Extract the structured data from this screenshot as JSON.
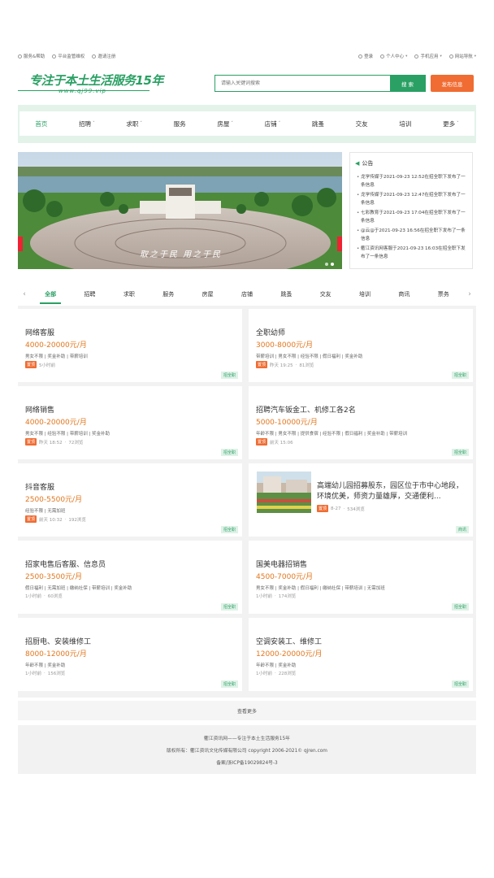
{
  "topbar": {
    "left": [
      "服务&帮助",
      "平台监管维权",
      "邀请注册"
    ],
    "right": [
      {
        "label": "登录",
        "caret": false
      },
      {
        "label": "个人中心",
        "caret": true
      },
      {
        "label": "手机应用",
        "caret": true
      },
      {
        "label": "网站导航",
        "caret": true
      }
    ]
  },
  "logo": {
    "title": "专注于本土生活服务15年",
    "url": "www.qj99.vip"
  },
  "search": {
    "placeholder": "请输入关键词搜索",
    "button": "搜 索"
  },
  "post_button": "发布信息",
  "nav": [
    {
      "label": "首页",
      "caret": false,
      "active": true
    },
    {
      "label": "招聘",
      "caret": true
    },
    {
      "label": "求职",
      "caret": true
    },
    {
      "label": "服务",
      "caret": false
    },
    {
      "label": "房屋",
      "caret": true
    },
    {
      "label": "店铺",
      "caret": true
    },
    {
      "label": "跳蚤",
      "caret": false
    },
    {
      "label": "交友",
      "caret": false
    },
    {
      "label": "培训",
      "caret": false
    },
    {
      "label": "更多",
      "caret": true
    }
  ],
  "banner": {
    "caption": "取之于民  用之于民",
    "slides": 2,
    "active_slide": 1
  },
  "notice": {
    "title": "公告",
    "items": [
      "龙学传媒于2021-09-23 12:52在招全职下发布了一条信息",
      "龙学传媒于2021-09-23 12:47在招全职下发布了一条信息",
      "七彩教育于2021-09-23 17:04在招全职下发布了一条信息",
      "@云@于2021-09-23 16:56在招全职下发布了一条信息",
      "衢江资讯网客服于2021-09-23 16:03在招全职下发布了一条信息"
    ]
  },
  "categories": {
    "items": [
      "全部",
      "招聘",
      "求职",
      "服务",
      "房屋",
      "店铺",
      "跳蚤",
      "交友",
      "培训",
      "商讯",
      "票务"
    ],
    "active_index": 0
  },
  "listings": [
    {
      "title": "网络客服",
      "price": "4000-20000元/月",
      "tags": "男女不限 | 奖金补助 | 带薪培训",
      "top": "置顶",
      "time": "5小时前",
      "views": "",
      "type": "招全职"
    },
    {
      "title": "全职幼师",
      "price": "3000-8000元/月",
      "tags": "带薪培训 | 男女不限 | 经验不限 | 假日福利 | 奖金补助",
      "top": "置顶",
      "time": "昨天 19:25",
      "views": "81浏览",
      "type": "招全职"
    },
    {
      "title": "网络销售",
      "price": "4000-20000元/月",
      "tags": "男女不限 | 经验不限 | 带薪培训 | 奖金补助",
      "top": "置顶",
      "time": "昨天 18:52",
      "views": "72浏览",
      "type": "招全职"
    },
    {
      "title": "招聘汽车钣金工、机修工各2名",
      "price": "5000-10000元/月",
      "tags": "年龄不限 | 男女不限 | 提供食宿 | 经验不限 | 假日福利 | 奖金补助 | 带薪培训",
      "top": "置顶",
      "time": "前天 15:06",
      "views": "",
      "type": "招全职"
    },
    {
      "title": "抖音客服",
      "price": "2500-5500元/月",
      "tags": "经验不限 | 无需加班",
      "top": "置顶",
      "time": "前天 10:32",
      "views": "192浏览",
      "type": "招全职"
    },
    {
      "title": "高端幼儿园招募股东，园区位于市中心地段，环境优美，师资力量雄厚，交通便利...",
      "price": "",
      "tags": "",
      "top": "置顶",
      "time": "8-27",
      "views": "534浏览",
      "type": "商讯"
    },
    {
      "title": "招家电售后客服、信息员",
      "price": "2500-3500元/月",
      "tags": "假日福利 | 无需加班 | 缴纳社保 | 带薪培训 | 奖金补助",
      "top": "",
      "time": "1小时前",
      "views": "60浏览",
      "type": "招全职"
    },
    {
      "title": "国美电器招销售",
      "price": "4500-7000元/月",
      "tags": "男女不限 | 奖金补助 | 假日福利 | 缴纳社保 | 带薪培训 | 无需加班",
      "top": "",
      "time": "1小时前",
      "views": "174浏览",
      "type": "招全职"
    },
    {
      "title": "招厨电、安装维修工",
      "price": "8000-12000元/月",
      "tags": "年龄不限 | 奖金补助",
      "top": "",
      "time": "1小时前",
      "views": "156浏览",
      "type": "招全职"
    },
    {
      "title": "空调安装工、维修工",
      "price": "12000-20000元/月",
      "tags": "年龄不限 | 奖金补助",
      "top": "",
      "time": "1小时前",
      "views": "228浏览",
      "type": "招全职"
    }
  ],
  "more_label": "查看更多",
  "footer": {
    "line1": "衢江资讯网——专注于本土生活服务15年",
    "line2": "版权所有：衢江资讯文化传媒有限公司 copyright 2006-2021© qjren.com",
    "line3": "备案/浙ICP备19029824号-3"
  },
  "colors": {
    "brand_green": "#2aa064",
    "accent_orange": "#f06c32",
    "price_orange": "#e2771e"
  }
}
